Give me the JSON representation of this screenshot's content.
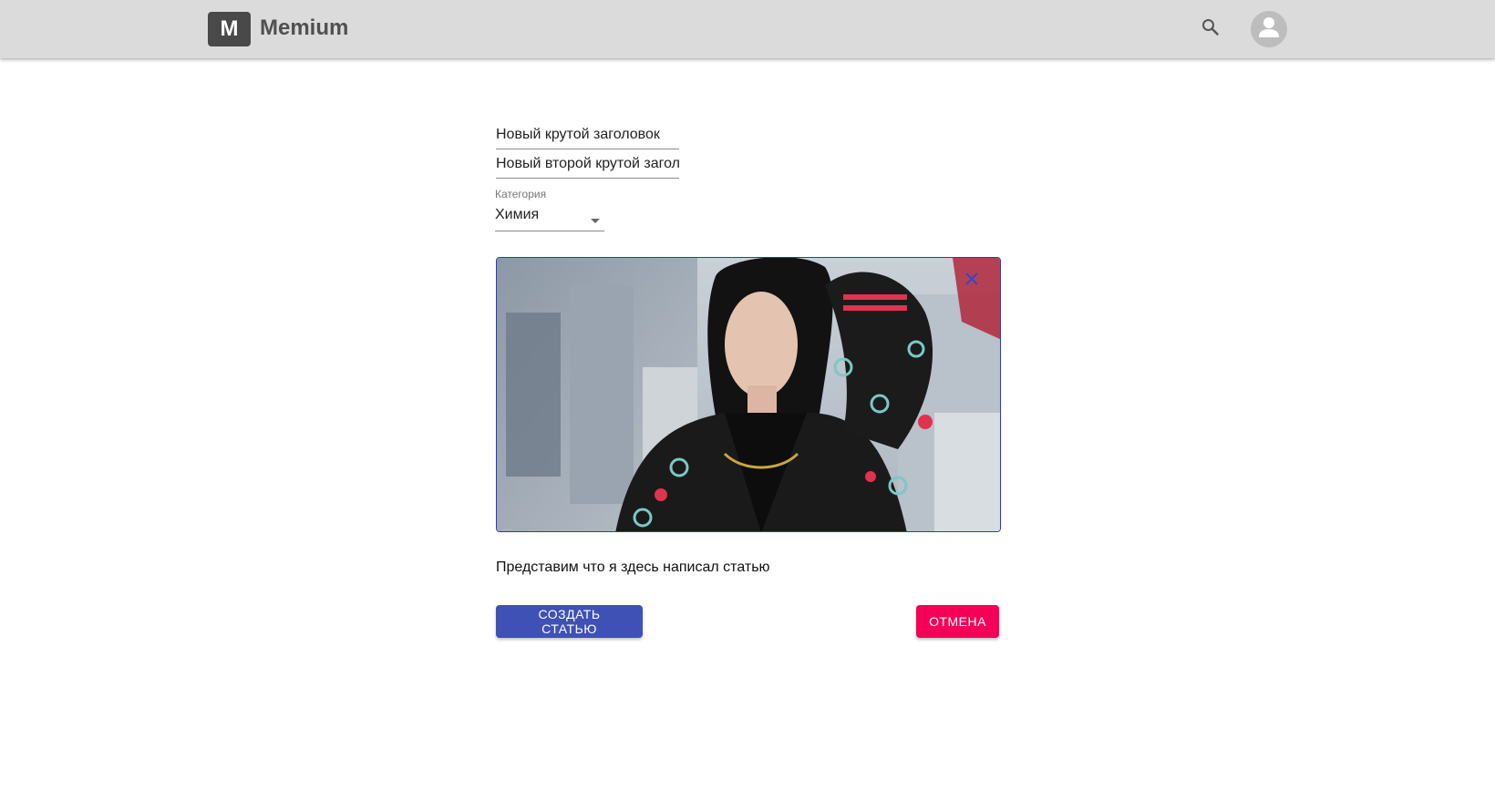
{
  "header": {
    "logo_letter": "M",
    "brand": "Memium",
    "search_icon": "search-icon",
    "avatar_icon": "person-icon"
  },
  "form": {
    "title_value": "Новый крутой заголовок",
    "subtitle_value": "Новый второй крутой заголовок",
    "category_label": "Категория",
    "category_value": "Химия",
    "image_close_icon": "close-icon",
    "article_text": "Представим что я здесь написал статью",
    "create_button": "СОЗДАТЬ СТАТЬЮ",
    "cancel_button": "ОТМЕНА"
  },
  "colors": {
    "appbar": "#dcdbdc",
    "primary": "#3f51b5",
    "secondary": "#f50057",
    "image_border": "#2a36d6"
  }
}
